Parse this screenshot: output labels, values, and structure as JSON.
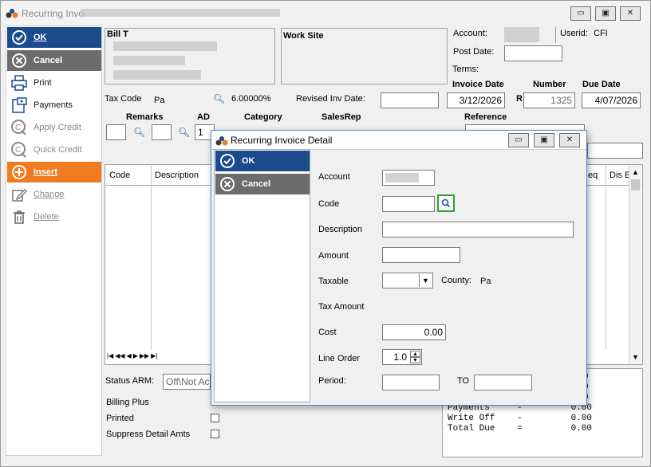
{
  "window": {
    "title": "Recurring Invoi",
    "buttons": {
      "minimize": "▭",
      "restore": "▣",
      "close": "✕"
    }
  },
  "sidebar": {
    "items": [
      {
        "label": "OK",
        "icon": "check-circle-icon"
      },
      {
        "label": "Cancel",
        "icon": "x-circle-icon"
      },
      {
        "label": "Print",
        "icon": "printer-icon"
      },
      {
        "label": "Payments",
        "icon": "payments-icon"
      },
      {
        "label": "Apply Credit",
        "icon": "apply-credit-icon"
      },
      {
        "label": "Quick Credit",
        "icon": "quick-credit-icon"
      },
      {
        "label": "Insert",
        "icon": "plus-circle-icon"
      },
      {
        "label": "Change",
        "icon": "edit-icon"
      },
      {
        "label": "Delete",
        "icon": "trash-icon"
      }
    ]
  },
  "header": {
    "bill_to_label": "Bill T",
    "work_site_label": "Work Site",
    "account_label": "Account:",
    "userid_label": "Userid:",
    "userid_value": "CFI",
    "post_date_label": "Post Date:",
    "terms_label": "Terms:",
    "invoice_date_label": "Invoice Date",
    "number_label": "Number",
    "due_date_label": "Due Date",
    "invoice_date": "3/12/2026",
    "number_prefix": "R",
    "number": "1325",
    "due_date": "4/07/2026",
    "tax_code_label": "Tax Code",
    "tax_code_value": "Pa",
    "tax_rate": "6.00000%",
    "revised_inv_date_label": "Revised Inv Date:",
    "remarks_label": "Remarks",
    "ad_label": "AD",
    "ad_value": "1",
    "category_label": "Category",
    "salesrep_label": "SalesRep",
    "reference_label": "Reference"
  },
  "grid": {
    "columns": [
      "Code",
      "Description",
      "eq",
      "Dis E"
    ],
    "nav": [
      "|◀",
      "◀◀",
      "◀",
      "▶",
      "▶▶",
      "▶|"
    ]
  },
  "footer": {
    "status_arm_label": "Status ARM:",
    "status_arm_value": "Off\\Not Ac",
    "billing_plus_label": "Billing Plus",
    "printed_label": "Printed",
    "suppress_label": "Suppress Detail Amts",
    "totals": [
      {
        "label": "Payments",
        "sign": "-",
        "value": "0.00"
      },
      {
        "label": "Write Off",
        "sign": "-",
        "value": "0.00"
      },
      {
        "label": "Total Due",
        "sign": "=",
        "value": "0.00"
      }
    ],
    "totals_partial": [
      "0",
      "0",
      "0"
    ]
  },
  "dialog": {
    "title": "Recurring Invoice Detail",
    "ok_label": "OK",
    "cancel_label": "Cancel",
    "account_label": "Account",
    "code_label": "Code",
    "description_label": "Description",
    "amount_label": "Amount",
    "taxable_label": "Taxable",
    "county_label": "County:",
    "county_value": "Pa",
    "tax_amount_label": "Tax Amount",
    "cost_label": "Cost",
    "cost_value": "0.00",
    "line_order_label": "Line Order",
    "line_order_value": "1.0",
    "period_label": "Period:",
    "to_label": "TO"
  },
  "colors": {
    "primary_blue": "#1b4a8d",
    "cancel_gray": "#6c6c6c",
    "insert_orange": "#f07b21",
    "focus_green": "#2aa52a"
  }
}
